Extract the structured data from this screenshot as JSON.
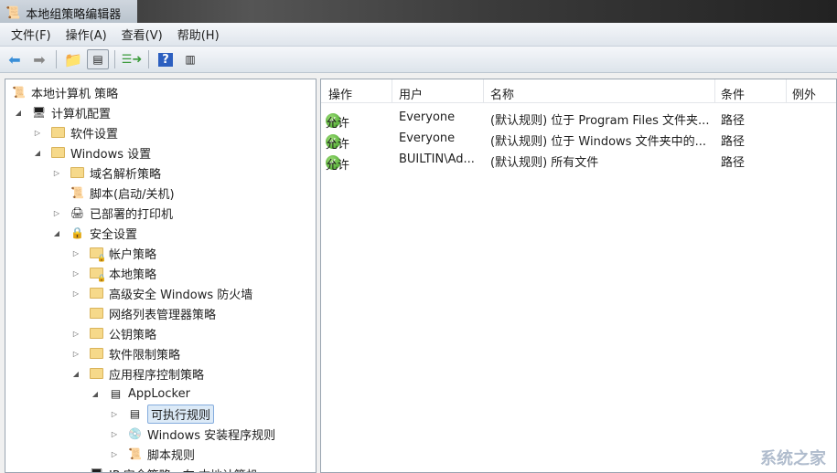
{
  "window": {
    "title": "本地组策略编辑器"
  },
  "menu": [
    "文件(F)",
    "操作(A)",
    "查看(V)",
    "帮助(H)"
  ],
  "tree": [
    {
      "label": "本地计算机 策略",
      "level": 0,
      "arrow": "",
      "icon": "policy-scroll-icon"
    },
    {
      "label": "计算机配置",
      "level": 1,
      "arrow": "◢",
      "icon": "computer-icon"
    },
    {
      "label": "软件设置",
      "level": 2,
      "arrow": "▷",
      "icon": "folder-icon"
    },
    {
      "label": "Windows 设置",
      "level": 2,
      "arrow": "◢",
      "icon": "folder-icon"
    },
    {
      "label": "域名解析策略",
      "level": 3,
      "arrow": "▷",
      "icon": "folder-icon"
    },
    {
      "label": "脚本(启动/关机)",
      "level": 3,
      "arrow": "",
      "icon": "script-icon"
    },
    {
      "label": "已部署的打印机",
      "level": 3,
      "arrow": "▷",
      "icon": "printer-icon"
    },
    {
      "label": "安全设置",
      "level": 3,
      "arrow": "◢",
      "icon": "security-icon"
    },
    {
      "label": "帐户策略",
      "level": 4,
      "arrow": "▷",
      "icon": "locked-folder-icon"
    },
    {
      "label": "本地策略",
      "level": 4,
      "arrow": "▷",
      "icon": "locked-folder-icon"
    },
    {
      "label": "高级安全 Windows 防火墙",
      "level": 4,
      "arrow": "▷",
      "icon": "folder-icon"
    },
    {
      "label": "网络列表管理器策略",
      "level": 4,
      "arrow": "",
      "icon": "folder-icon"
    },
    {
      "label": "公钥策略",
      "level": 4,
      "arrow": "▷",
      "icon": "folder-icon"
    },
    {
      "label": "软件限制策略",
      "level": 4,
      "arrow": "▷",
      "icon": "folder-icon"
    },
    {
      "label": "应用程序控制策略",
      "level": 4,
      "arrow": "◢",
      "icon": "folder-icon"
    },
    {
      "label": "AppLocker",
      "level": 5,
      "arrow": "◢",
      "icon": "applocker-icon"
    },
    {
      "label": "可执行规则",
      "level": 6,
      "arrow": "▷",
      "icon": "window-icon",
      "selected": true
    },
    {
      "label": "Windows 安装程序规则",
      "level": 6,
      "arrow": "▷",
      "icon": "installer-icon"
    },
    {
      "label": "脚本规则",
      "level": 6,
      "arrow": "▷",
      "icon": "script-icon"
    },
    {
      "label": "IP 安全策略，在 本地计算机",
      "level": 4,
      "arrow": "▷",
      "icon": "ip-security-icon"
    }
  ],
  "columns": [
    "操作",
    "用户",
    "名称",
    "条件",
    "例外"
  ],
  "rows": [
    {
      "action": "允许",
      "user": "Everyone",
      "name": "(默认规则) 位于 Program Files 文件夹...",
      "condition": "路径",
      "exception": ""
    },
    {
      "action": "允许",
      "user": "Everyone",
      "name": "(默认规则) 位于 Windows 文件夹中的...",
      "condition": "路径",
      "exception": ""
    },
    {
      "action": "允许",
      "user": "BUILTIN\\Ad...",
      "name": "(默认规则) 所有文件",
      "condition": "路径",
      "exception": ""
    }
  ],
  "watermark": "系统之家"
}
